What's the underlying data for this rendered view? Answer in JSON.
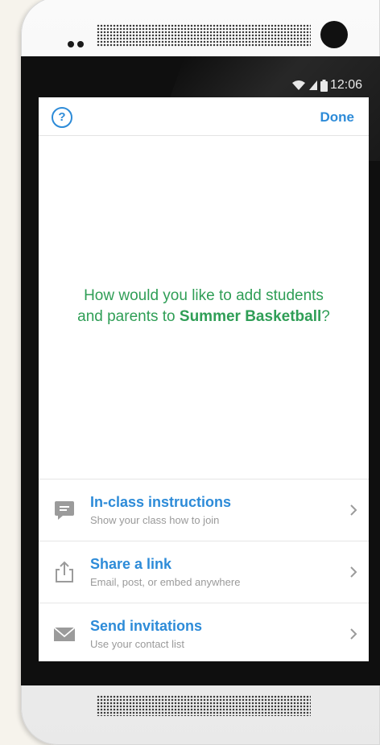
{
  "status_bar": {
    "time": "12:06",
    "icons": [
      "wifi-icon",
      "signal-icon",
      "battery-icon"
    ]
  },
  "navbar": {
    "help_label": "?",
    "done_label": "Done"
  },
  "prompt": {
    "line1": "How would you like to add students",
    "line2_prefix": "and parents to ",
    "class_name": "Summer Basketball",
    "line2_suffix": "?"
  },
  "options": [
    {
      "title": "In-class instructions",
      "subtitle": "Show your class how to join",
      "icon": "chat-bubble-icon"
    },
    {
      "title": "Share a link",
      "subtitle": "Email, post, or embed anywhere",
      "icon": "share-icon"
    },
    {
      "title": "Send invitations",
      "subtitle": "Use your contact list",
      "icon": "envelope-icon"
    }
  ],
  "colors": {
    "accent_blue": "#2d8bd8",
    "prompt_green": "#2f9e56",
    "icon_gray": "#9b9b9b"
  }
}
